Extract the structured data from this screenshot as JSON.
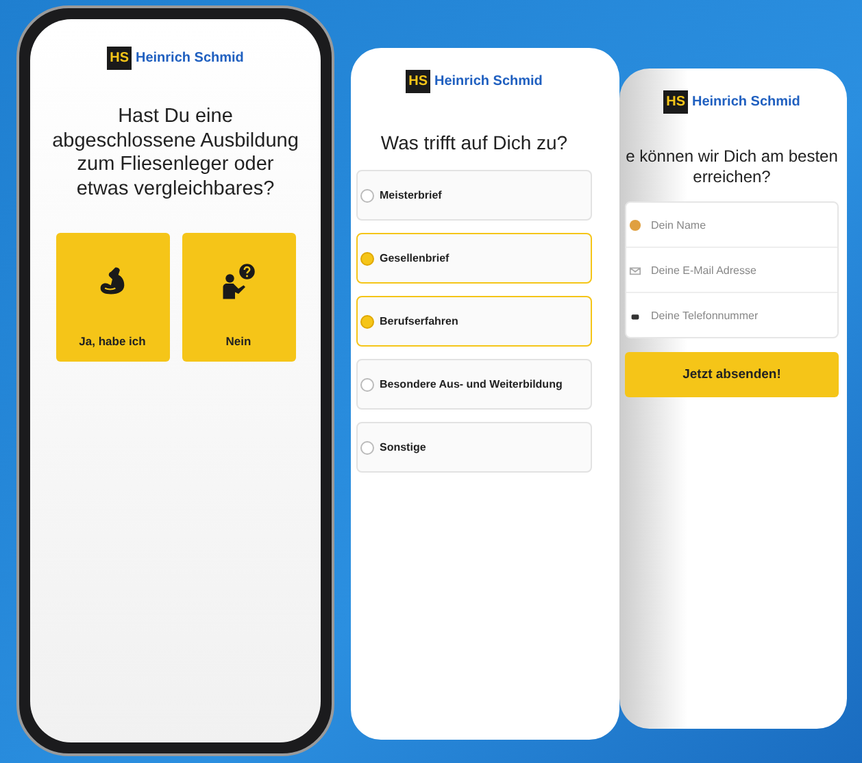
{
  "screens": [
    {
      "kind": "question",
      "brand": "Heinrich Schmid",
      "logo": "HS",
      "title": "Hast Du eine abgeschlossene Ausbildung zum Fliesenleger oder etwas vergleichbares?",
      "answers": [
        {
          "label": "Ja, habe ich"
        },
        {
          "label": "Nein"
        }
      ]
    },
    {
      "kind": "choice",
      "brand": "Heinrich Schmid",
      "logo": "HS",
      "title": "Was trifft auf Dich zu?",
      "options": [
        {
          "label": "Meisterbrief",
          "selected": false
        },
        {
          "label": "Gesellenbrief",
          "selected": true
        },
        {
          "label": "Berufserfahren",
          "selected": true
        },
        {
          "label": "Besondere Aus- und Weiterbildung",
          "selected": false
        },
        {
          "label": "Sonstige",
          "selected": false
        }
      ]
    },
    {
      "kind": "form",
      "brand": "Heinrich Schmid",
      "logo": "HS",
      "title": "e können wir Dich am besten erreichen?",
      "fields": [
        {
          "placeholder": "Dein Name"
        },
        {
          "placeholder": "Deine E-Mail Adresse"
        },
        {
          "placeholder": "Deine Telefonnummer"
        }
      ],
      "submit": "Jetzt absenden!"
    }
  ]
}
